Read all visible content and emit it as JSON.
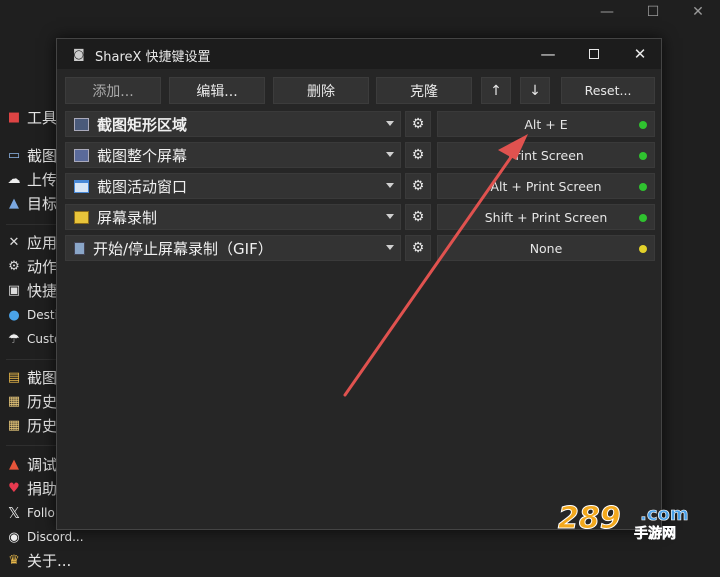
{
  "background_app": {
    "menu_items": [
      {
        "label": "工具",
        "icon": "toolbox-icon"
      },
      {
        "label": "截图",
        "icon": "capture-icon"
      },
      {
        "label": "上传",
        "icon": "cloud-upload-icon"
      },
      {
        "label": "目标",
        "icon": "target-icon"
      },
      {
        "label": "应用",
        "icon": "wrench-icon"
      },
      {
        "label": "动作",
        "icon": "gear-icon"
      },
      {
        "label": "快捷",
        "icon": "shortcut-icon"
      },
      {
        "label": "Desti",
        "icon": "globe-icon"
      },
      {
        "label": "Custo",
        "icon": "cloud-icon"
      },
      {
        "label": "截图",
        "icon": "folder-icon"
      },
      {
        "label": "历史",
        "icon": "history-icon"
      },
      {
        "label": "历史",
        "icon": "history-grid-icon"
      },
      {
        "label": "调试",
        "icon": "cone-icon"
      },
      {
        "label": "捐助",
        "icon": "heart-icon"
      },
      {
        "label": "Follo",
        "icon": "x-logo-icon"
      },
      {
        "label": "Discord...",
        "icon": "discord-icon"
      },
      {
        "label": "关于...",
        "icon": "crown-icon"
      }
    ]
  },
  "dialog": {
    "title": "ShareX 快捷键设置",
    "toolbar": {
      "add_label": "添加...",
      "edit_label": "编辑...",
      "delete_label": "删除",
      "clone_label": "克隆",
      "up_label": "↑",
      "down_label": "↓",
      "reset_label": "Reset..."
    },
    "hotkeys": [
      {
        "task": "截图矩形区域",
        "hotkey": "Alt + E",
        "status_color": "#2fc22f",
        "bold": true
      },
      {
        "task": "截图整个屏幕",
        "hotkey": "Print Screen",
        "status_color": "#2fc22f",
        "bold": false
      },
      {
        "task": "截图活动窗口",
        "hotkey": "Alt + Print Screen",
        "status_color": "#2fc22f",
        "bold": false
      },
      {
        "task": "屏幕录制",
        "hotkey": "Shift + Print Screen",
        "status_color": "#2fc22f",
        "bold": false
      },
      {
        "task": "开始/停止屏幕录制（GIF）",
        "hotkey": "None",
        "status_color": "#e2d12a",
        "bold": false
      }
    ]
  },
  "watermark": {
    "text": "289",
    "suffix": ".com",
    "subtitle": "手游网"
  },
  "colors": {
    "accent_arrow": "#e0524f",
    "ok": "#2fc22f",
    "warn": "#e2d12a"
  }
}
